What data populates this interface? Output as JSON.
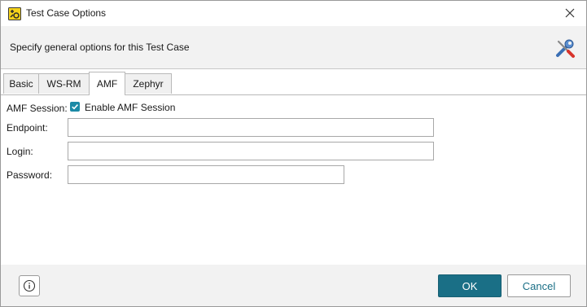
{
  "window": {
    "title": "Test Case Options",
    "app_icon": "soapui-app-icon",
    "close_icon": "close-icon"
  },
  "header": {
    "description": "Specify general options for this Test Case",
    "icon": "tools-icon"
  },
  "tabs": [
    {
      "label": "Basic",
      "active": false
    },
    {
      "label": "WS-RM",
      "active": false
    },
    {
      "label": "AMF",
      "active": true
    },
    {
      "label": "Zephyr",
      "active": false
    }
  ],
  "amf": {
    "session_label": "AMF Session:",
    "enable_label": "Enable AMF Session",
    "enable_checked": true,
    "endpoint_label": "Endpoint:",
    "endpoint_value": "",
    "login_label": "Login:",
    "login_value": "",
    "password_label": "Password:",
    "password_value": ""
  },
  "footer": {
    "info_icon": "info-icon",
    "ok_label": "OK",
    "cancel_label": "Cancel"
  },
  "colors": {
    "accent": "#1a6f86",
    "checkbox": "#1b8aa6",
    "header_bg": "#f2f2f2"
  }
}
